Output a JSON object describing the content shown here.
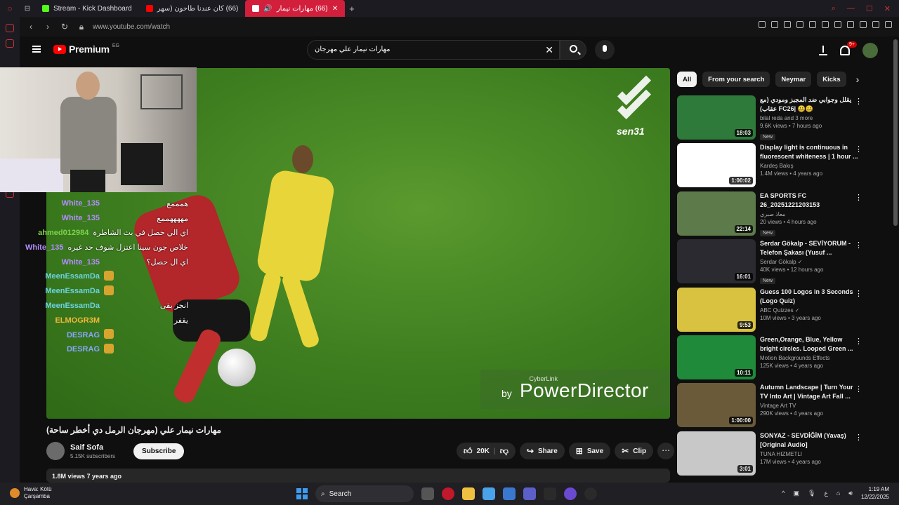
{
  "browser": {
    "tabs": [
      {
        "label": "Stream - Kick Dashboard"
      },
      {
        "label": "(66) كان عندنا طاحون (سهر"
      },
      {
        "label": "(66) مهارات نيمار"
      }
    ],
    "url": "www.youtube.com/watch"
  },
  "youtube": {
    "logo_text": "Premium",
    "country": "EG",
    "search_query": "مهارات نيمار علي مهرجان",
    "notification_count": "9+"
  },
  "player": {
    "watermark": "sen31",
    "overlay_small": "CyberLink",
    "overlay_by": "by",
    "overlay_brand": "PowerDirector"
  },
  "chat": [
    {
      "user": "White_135",
      "color": "#b38cff",
      "message": "همممع"
    },
    {
      "user": "White_135",
      "color": "#b38cff",
      "message": "مههههممع"
    },
    {
      "user": "ahmed012984",
      "color": "#7cd34a",
      "message": "اي الي حصل في بث الشاطرة"
    },
    {
      "user": "White_135",
      "color": "#b38cff",
      "message": "خلاص جون سينا اعتزل شوف حد غيره"
    },
    {
      "user": "White_135",
      "color": "#b38cff",
      "message": "اي ال حصل؟"
    },
    {
      "user": "MeenEssamDa",
      "color": "#6bd3e0",
      "message": ""
    },
    {
      "user": "MeenEssamDa",
      "color": "#6bd3e0",
      "message": ""
    },
    {
      "user": "MeenEssamDa",
      "color": "#6bd3e0",
      "message": "انجز بقى"
    },
    {
      "user": "ELMOGR3M",
      "color": "#f0b838",
      "message": "يقفر"
    },
    {
      "user": "DESRAG",
      "color": "#8aa4ff",
      "message": ""
    },
    {
      "user": "DESRAG",
      "color": "#8aa4ff",
      "message": ""
    }
  ],
  "video": {
    "title": "مهارات نيمار علي (مهرجان الرمل دي أخطر ساحة)",
    "channel": "Saif Sofa",
    "subscribers": "5.15K subscribers",
    "subscribe_label": "Subscribe",
    "likes": "20K",
    "share_label": "Share",
    "save_label": "Save",
    "clip_label": "Clip",
    "more_label": "⋯",
    "views_line": "1.8M views  7 years ago"
  },
  "chips": [
    "All",
    "From your search",
    "Neymar",
    "Kicks"
  ],
  "recommendations": [
    {
      "title": "يقلل وجوابي ضد المجبز ومودي (مع عقاب) FC26| 🤐🤐",
      "channel": "bilal reda and 3 more",
      "meta": "9.6K views • 7 hours ago",
      "badge": "New",
      "duration": "18:03",
      "thumb_color": "#2e7a3a"
    },
    {
      "title": "Display light is continuous in fluorescent whiteness | 1 hour ...",
      "channel": "Kardeş Bakış",
      "meta": "1.4M views • 4 years ago",
      "badge": "",
      "duration": "1:00:02",
      "thumb_color": "#ffffff"
    },
    {
      "title": "EA SPORTS FC 26_20251221203153",
      "channel": "معاذ صبري",
      "meta": "20 views • 4 hours ago",
      "badge": "New",
      "duration": "22:14",
      "thumb_color": "#5d7a4a"
    },
    {
      "title": "Serdar Gökalp - SEVİYORUM - Telefon Şakası (Yusuf ...",
      "channel": "Serdar Gökalp ✓",
      "meta": "40K views • 12 hours ago",
      "badge": "New",
      "duration": "16:01",
      "thumb_color": "#2a2a30"
    },
    {
      "title": "Guess 100 Logos in 3 Seconds (Logo Quiz)",
      "channel": "ABC Quizzes ✓",
      "meta": "10M views • 3 years ago",
      "badge": "",
      "duration": "9:53",
      "thumb_color": "#d8c240"
    },
    {
      "title": "Green,Orange, Blue, Yellow bright circles. Looped Green ...",
      "channel": "Motion Backgrounds Effects",
      "meta": "125K views • 4 years ago",
      "badge": "",
      "duration": "10:11",
      "thumb_color": "#1e8a3a"
    },
    {
      "title": "Autumn Landscape | Turn Your TV Into Art | Vintage Art Fall ...",
      "channel": "Vintage Art TV",
      "meta": "290K views • 4 years ago",
      "badge": "",
      "duration": "1:00:00",
      "thumb_color": "#6a5a3a"
    },
    {
      "title": "SONYAZ - SEVDİĞİM (Yavaş) [Original Audio]",
      "channel": "TUNA HIZMETLI",
      "meta": "17M views • 4 years ago",
      "badge": "",
      "duration": "3:01",
      "thumb_color": "#c8c8c8"
    }
  ],
  "taskbar": {
    "weather_line1": "Hava: Kötü",
    "weather_line2": "Çarşamba",
    "search_label": "Search",
    "time": "1:19 AM",
    "date": "12/22/2025"
  }
}
